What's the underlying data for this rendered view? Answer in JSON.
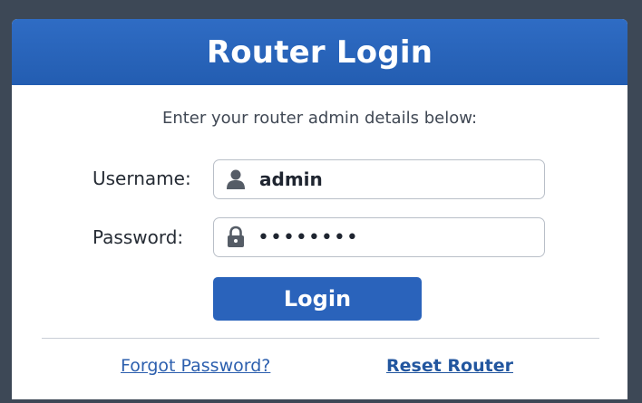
{
  "header": {
    "title": "Router Login"
  },
  "form": {
    "subtitle": "Enter your router admin details below:",
    "username": {
      "label": "Username:",
      "value": "admin",
      "icon": "user-icon"
    },
    "password": {
      "label": "Password:",
      "masked_value": "••••••••",
      "icon": "lock-icon"
    },
    "login_label": "Login"
  },
  "links": {
    "forgot": "Forgot Password?",
    "reset": "Reset Router"
  },
  "colors": {
    "accent": "#2a63bb",
    "header": "#2f6cc4",
    "frame": "#3d4856",
    "link": "#2c5fae"
  }
}
